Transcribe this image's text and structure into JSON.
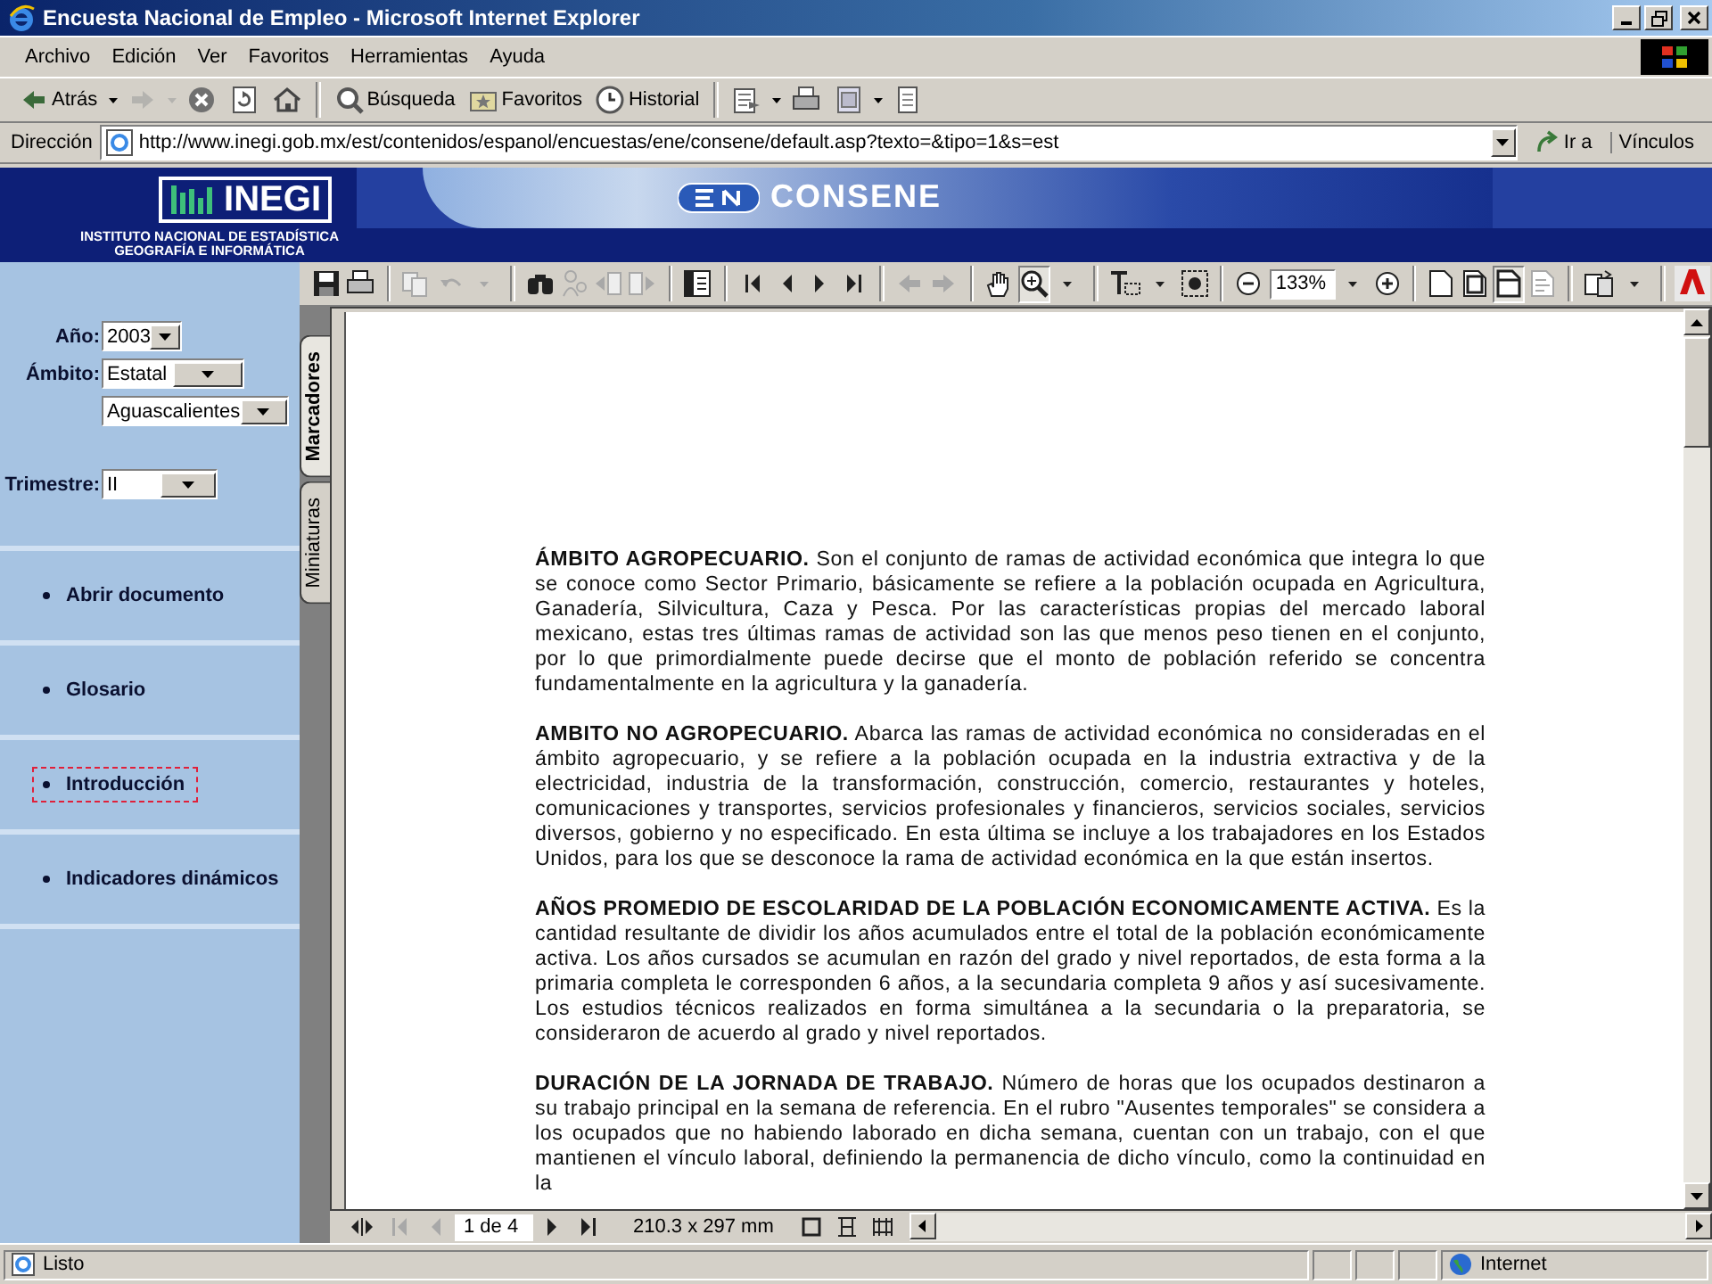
{
  "window": {
    "title": "Encuesta Nacional de Empleo - Microsoft Internet Explorer"
  },
  "menu_bar": [
    "Archivo",
    "Edición",
    "Ver",
    "Favoritos",
    "Herramientas",
    "Ayuda"
  ],
  "toolbar": [
    {
      "kind": "back",
      "label": "Atrás",
      "disabled": false
    },
    {
      "kind": "caret",
      "disabled": false
    },
    {
      "kind": "forward",
      "disabled": true
    },
    {
      "kind": "caret",
      "disabled": true
    },
    {
      "kind": "stop",
      "disabled": false
    },
    {
      "kind": "refresh",
      "disabled": false
    },
    {
      "kind": "home",
      "disabled": false
    },
    {
      "kind": "sep"
    },
    {
      "kind": "search",
      "label": "Búsqueda",
      "disabled": false
    },
    {
      "kind": "favorites",
      "label": "Favoritos",
      "disabled": false
    },
    {
      "kind": "history",
      "label": "Historial",
      "disabled": false
    },
    {
      "kind": "sep"
    },
    {
      "kind": "mail",
      "disabled": false
    },
    {
      "kind": "caret",
      "disabled": false
    },
    {
      "kind": "print",
      "disabled": false
    },
    {
      "kind": "edit",
      "disabled": false
    },
    {
      "kind": "caret",
      "disabled": false
    },
    {
      "kind": "discuss",
      "disabled": false
    }
  ],
  "address_bar": {
    "label": "Dirección",
    "url": "http://www.inegi.gob.mx/est/contenidos/espanol/encuestas/ene/consene/default.asp?texto=&tipo=1&s=est",
    "go": "Ir a",
    "links": "Vínculos"
  },
  "site_header": {
    "logo": "INEGI",
    "subtitle": [
      "INSTITUTO NACIONAL DE ESTADÍSTICA",
      "GEOGRAFÍA E INFORMÁTICA"
    ],
    "banner": "CONSENE"
  },
  "filters": [
    {
      "label": "Año:",
      "value": "2003"
    },
    {
      "label": "Ámbito:",
      "value": "Estatal"
    },
    {
      "value": "Aguascalientes"
    },
    {
      "label": "Trimestre:",
      "value": "II"
    }
  ],
  "nav_links": [
    {
      "label": "Abrir documento",
      "focused": false
    },
    {
      "label": "Glosario",
      "focused": false
    },
    {
      "label": "Introducción",
      "focused": true
    },
    {
      "label": "Indicadores dinámicos",
      "focused": false
    }
  ],
  "pdf_toolbar": [
    {
      "kind": "save",
      "disabled": false,
      "pressed": false
    },
    {
      "kind": "print",
      "disabled": false,
      "pressed": false
    },
    {
      "kind": "sep"
    },
    {
      "kind": "copy",
      "disabled": true,
      "pressed": false
    },
    {
      "kind": "undo",
      "disabled": true,
      "pressed": false
    },
    {
      "kind": "caret",
      "disabled": true,
      "pressed": false
    },
    {
      "kind": "sep"
    },
    {
      "kind": "find",
      "disabled": false,
      "pressed": false
    },
    {
      "kind": "search",
      "disabled": true,
      "pressed": false
    },
    {
      "kind": "prev-doc",
      "disabled": true,
      "pressed": false
    },
    {
      "kind": "next-doc",
      "disabled": true,
      "pressed": false
    },
    {
      "kind": "sep"
    },
    {
      "kind": "panel",
      "disabled": false,
      "pressed": false
    },
    {
      "kind": "sep"
    },
    {
      "kind": "first",
      "disabled": false,
      "pressed": false
    },
    {
      "kind": "prev",
      "disabled": false,
      "pressed": false
    },
    {
      "kind": "next",
      "disabled": false,
      "pressed": false
    },
    {
      "kind": "last",
      "disabled": false,
      "pressed": false
    },
    {
      "kind": "sep"
    },
    {
      "kind": "back",
      "disabled": true,
      "pressed": false
    },
    {
      "kind": "forward",
      "disabled": true,
      "pressed": false
    },
    {
      "kind": "sep"
    },
    {
      "kind": "hand",
      "disabled": false,
      "pressed": false
    },
    {
      "kind": "zoom-in",
      "disabled": false,
      "pressed": true
    },
    {
      "kind": "caret",
      "disabled": false,
      "pressed": false
    },
    {
      "kind": "sep"
    },
    {
      "kind": "text-select",
      "disabled": false,
      "pressed": false
    },
    {
      "kind": "caret",
      "disabled": false,
      "pressed": false
    },
    {
      "kind": "snapshot",
      "disabled": false,
      "pressed": false
    },
    {
      "kind": "sep"
    },
    {
      "kind": "zoom-out",
      "disabled": false,
      "pressed": false
    },
    {
      "kind": "zoom-field",
      "value": "133%"
    },
    {
      "kind": "caret",
      "disabled": false,
      "pressed": false
    },
    {
      "kind": "zoom-plus",
      "disabled": false,
      "pressed": false
    },
    {
      "kind": "sep"
    },
    {
      "kind": "actual-size",
      "disabled": false,
      "pressed": false
    },
    {
      "kind": "fit-page",
      "disabled": false,
      "pressed": false
    },
    {
      "kind": "fit-width",
      "disabled": false,
      "pressed": true
    },
    {
      "kind": "reflow",
      "disabled": true,
      "pressed": false
    },
    {
      "kind": "sep"
    },
    {
      "kind": "rotate",
      "disabled": false,
      "pressed": false
    },
    {
      "kind": "caret",
      "disabled": false,
      "pressed": false
    },
    {
      "kind": "sep"
    },
    {
      "kind": "adobe",
      "disabled": false,
      "pressed": false
    }
  ],
  "side_tabs": [
    {
      "label": "Marcadores",
      "selected": true
    },
    {
      "label": "Miniaturas",
      "selected": false
    }
  ],
  "document": {
    "paragraphs": [
      "**ÁMBITO AGROPECUARIO.** Son el conjunto de ramas de actividad económica que integra lo que se conoce como Sector Primario, básicamente se refiere a la población ocupada en Agricultura, Ganadería, Silvicultura, Caza y Pesca. Por las características propias del mercado laboral mexicano, estas tres últimas ramas de actividad son las que menos peso tienen en el conjunto, por lo que primordialmente puede decirse que el monto de población referido se concentra fundamentalmente en la agricultura y la ganadería.",
      "**AMBITO NO AGROPECUARIO.** Abarca las ramas de actividad económica no consideradas en el ámbito agropecuario, y se refiere a la población ocupada en la industria extractiva y de la electricidad, industria de la transformación, construcción, comercio, restaurantes y hoteles, comunicaciones y transportes, servicios profesionales y financieros, servicios sociales, servicios diversos, gobierno y no especificado. En esta última se incluye a los trabajadores en los Estados Unidos, para los que se desconoce la rama de actividad económica en la que están insertos.",
      "**AÑOS PROMEDIO DE ESCOLARIDAD DE LA POBLACIÓN ECONOMICAMENTE ACTIVA.** Es la cantidad resultante de dividir los años acumulados entre el total de la población económicamente activa. Los años cursados se acumulan en razón del grado y nivel reportados, de esta forma a la primaria completa le corresponden 6 años, a la secundaria completa 9 años y así sucesivamente. Los estudios técnicos realizados en forma simultánea a la secundaria o la preparatoria, se consideraron de acuerdo al grado y nivel reportados.",
      "**DURACIÓN DE LA JORNADA DE TRABAJO.** Número de horas que los ocupados destinaron a su trabajo principal en la semana de referencia. En el rubro \"Ausentes temporales\" se considera a los ocupados que no habiendo laborado en dicha semana, cuentan con un trabajo, con el que mantienen el vínculo laboral, definiendo la permanencia de dicho vínculo, como la continuidad en la"
    ]
  },
  "viewer_footer": {
    "page": "1 de 4",
    "size": "210.3 x 297 mm"
  },
  "status_bar": {
    "text": "Listo",
    "zone": "Internet"
  }
}
